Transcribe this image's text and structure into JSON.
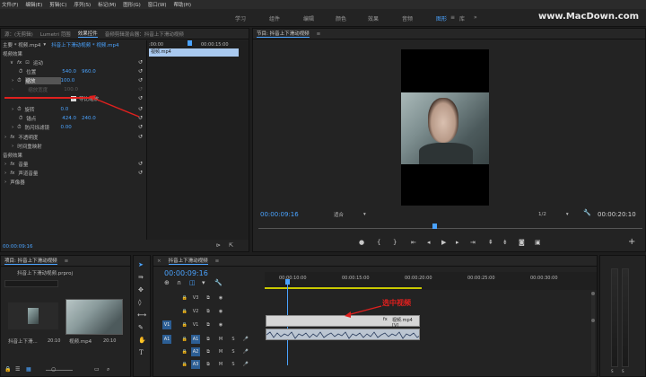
{
  "menu": [
    "文件(F)",
    "编辑(E)",
    "剪辑(C)",
    "序列(S)",
    "标记(M)",
    "图形(G)",
    "窗口(W)",
    "帮助(H)"
  ],
  "workspaces": [
    "学习",
    "组件",
    "编辑",
    "颜色",
    "效果",
    "音频",
    "图形",
    "库"
  ],
  "workspace_more": "»",
  "watermark": "www.MacDown.com",
  "effect_panel": {
    "tabs": [
      "源：(无剪辑)",
      "Lumetri 范围",
      "效果控件",
      "音频剪辑混合器：抖音上下滑动视频"
    ],
    "clip_path": "主要 * 视频.mp4",
    "clip_target": "抖音上下滑动视频 * 视频.mp4",
    "video_effects": "视频效果",
    "motion": "运动",
    "position_label": "位置",
    "position_x": "540.0",
    "position_y": "960.0",
    "scale_label": "缩放",
    "scale_value": "100.0",
    "scale_width_label": "缩放宽度",
    "scale_width_value": "100.0",
    "uniform_scale": "等比缩放",
    "rotation_label": "旋转",
    "rotation_value": "0.0",
    "anchor_label": "锚点",
    "anchor_x": "424.0",
    "anchor_y": "240.0",
    "flicker_label": "防闪烁滤镜",
    "flicker_value": "0.00",
    "opacity": "不透明度",
    "time_remap": "时间重映射",
    "audio_effects": "音频效果",
    "volume": "音量",
    "channel_volume": "声道音量",
    "panner": "声像器",
    "timecode": "00:00:09:16",
    "mini_timeline_start": ":00:00",
    "mini_timeline_end": "00:00:15:00",
    "mini_clip": "视频.mp4"
  },
  "program_monitor": {
    "title": "节目: 抖音上下滑动视频",
    "timecode": "00:00:09:16",
    "fit": "适合",
    "quality": "1/2",
    "duration": "00:00:20:10"
  },
  "project_panel": {
    "title": "项目: 抖音上下滑动视频",
    "file": "抖音上下滑动视频.prproj",
    "item1_label": "抖音上下滑...",
    "item1_duration": "20:10",
    "item2_label": "视频.mp4",
    "item2_duration": "20:10"
  },
  "timeline": {
    "title": "抖音上下滑动视频",
    "timecode": "00:00:09:16",
    "ruler": [
      "00:00:10:00",
      "00:00:15:00",
      "00:00:20:00",
      "00:00:25:00",
      "00:00:30:00"
    ],
    "tracks_video": [
      "V3",
      "V2",
      "V1"
    ],
    "tracks_audio": [
      "A1",
      "A2",
      "A3"
    ],
    "clip_label": "视频.mp4 [V]",
    "annotation": "选中视频"
  },
  "colors": {
    "accent": "#4aa3ff",
    "annotation": "#e0201e",
    "clip": "#d6d6d6"
  }
}
